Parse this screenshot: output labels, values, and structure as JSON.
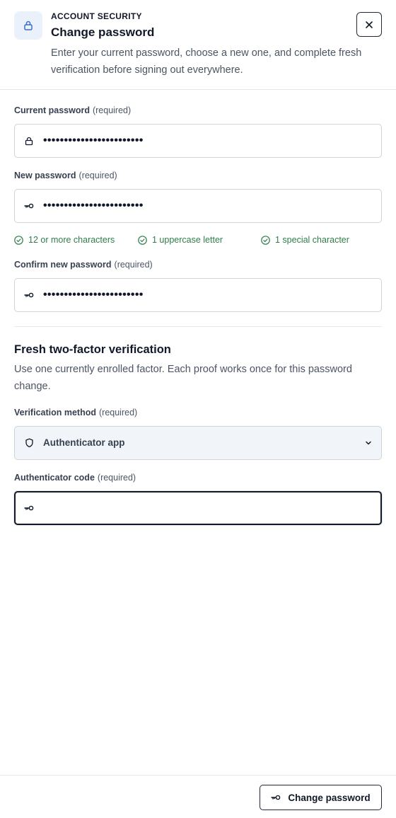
{
  "header": {
    "eyebrow": "ACCOUNT SECURITY",
    "title": "Change password",
    "description": "Enter your current password, choose a new one, and complete fresh verification before signing out everywhere.",
    "icon": "lock-icon",
    "close_icon": "close-icon"
  },
  "fields": {
    "current": {
      "label": "Current password",
      "required": "(required)",
      "value": "••••••••••••••••••••••••",
      "icon": "lock-icon"
    },
    "new": {
      "label": "New password",
      "required": "(required)",
      "value": "••••••••••••••••••••••••",
      "icon": "key-icon"
    },
    "confirm": {
      "label": "Confirm new password",
      "required": "(required)",
      "value": "••••••••••••••••••••••••",
      "icon": "key-icon"
    }
  },
  "rules": [
    {
      "text": "12 or more characters",
      "met": true
    },
    {
      "text": "1 uppercase letter",
      "met": true
    },
    {
      "text": "1 special character",
      "met": true
    }
  ],
  "verification": {
    "title": "Fresh two-factor verification",
    "description": "Use one currently enrolled factor. Each proof works once for this password change.",
    "method": {
      "label": "Verification method",
      "required": "(required)",
      "value": "Authenticator app",
      "icon": "shield-icon"
    },
    "code": {
      "label": "Authenticator code",
      "required": "(required)",
      "value": "",
      "icon": "key-icon"
    }
  },
  "footer": {
    "submit_label": "Change password",
    "submit_icon": "key-icon"
  },
  "colors": {
    "success": "#2f7d4a",
    "icon_bg": "#eaf1fb",
    "select_bg": "#f1f5f9"
  }
}
